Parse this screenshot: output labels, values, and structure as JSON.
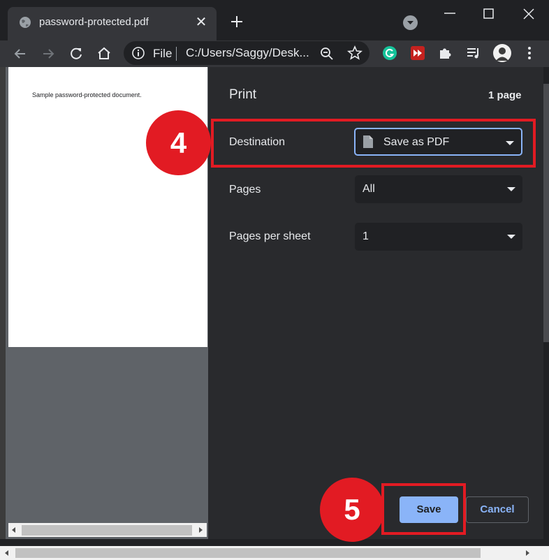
{
  "tab": {
    "title": "password-protected.pdf"
  },
  "omnibox": {
    "scheme_label": "File",
    "url": "C:/Users/Saggy/Desk..."
  },
  "preview": {
    "page_text": "Sample password-protected document."
  },
  "print": {
    "title": "Print",
    "sheet_count": "1 page",
    "destination": {
      "label": "Destination",
      "value": "Save as PDF"
    },
    "pages": {
      "label": "Pages",
      "value": "All"
    },
    "pages_per_sheet": {
      "label": "Pages per sheet",
      "value": "1"
    },
    "save_label": "Save",
    "cancel_label": "Cancel"
  },
  "annotations": {
    "step_destination": "4",
    "step_save": "5"
  },
  "colors": {
    "accent": "#8ab4f8",
    "callout": "#e21b23",
    "panel": "#292a2d"
  }
}
